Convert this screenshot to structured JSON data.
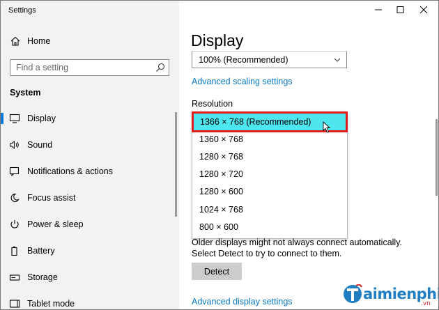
{
  "window": {
    "title": "Settings"
  },
  "sidebar": {
    "home_label": "Home",
    "search_placeholder": "Find a setting",
    "section_label": "System",
    "items": [
      {
        "label": "Display",
        "icon": "monitor-icon",
        "active": true
      },
      {
        "label": "Sound",
        "icon": "speaker-icon"
      },
      {
        "label": "Notifications & actions",
        "icon": "notifications-icon"
      },
      {
        "label": "Focus assist",
        "icon": "moon-icon"
      },
      {
        "label": "Power & sleep",
        "icon": "power-icon"
      },
      {
        "label": "Battery",
        "icon": "battery-icon"
      },
      {
        "label": "Storage",
        "icon": "storage-icon"
      },
      {
        "label": "Tablet mode",
        "icon": "tablet-icon"
      }
    ]
  },
  "main": {
    "title": "Display",
    "scale_value": "100% (Recommended)",
    "advanced_scaling_link": "Advanced scaling settings",
    "resolution_label": "Resolution",
    "resolution_options": [
      "1366 × 768 (Recommended)",
      "1360 × 768",
      "1280 × 768",
      "1280 × 720",
      "1280 × 600",
      "1024 × 768",
      "800 × 600"
    ],
    "selected_resolution": "1366 × 768 (Recommended)",
    "description": "Older displays might not always connect automatically. Select Detect to try to connect to them.",
    "detect_button": "Detect",
    "advanced_display_link": "Advanced display settings"
  },
  "watermark": {
    "brand": "aimienphi",
    "tld": ".vn"
  },
  "colors": {
    "accent": "#0078d7",
    "link": "#0a78c2",
    "highlight": "#4ee6ee",
    "highlight_border": "#e01b1b",
    "sidebar_bg": "#f2f2f2"
  }
}
